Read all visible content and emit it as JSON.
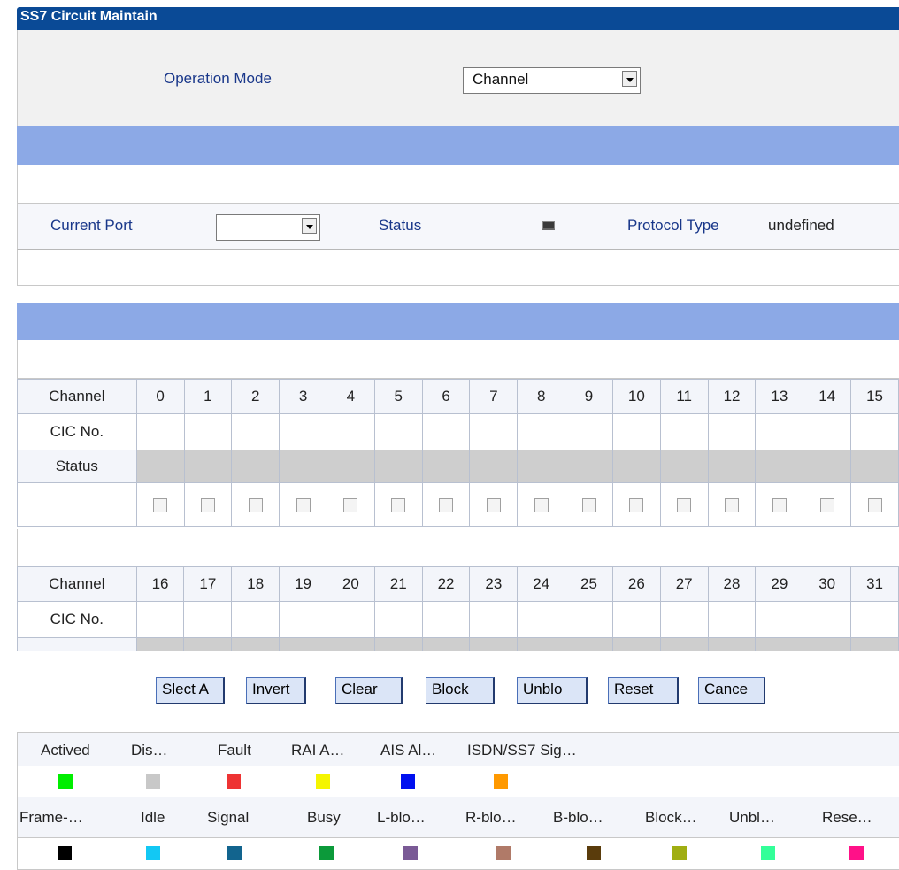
{
  "title": "SS7 Circuit Maintain",
  "operation_mode": {
    "label": "Operation Mode",
    "value": "Channel"
  },
  "port": {
    "label": "Current Port",
    "value": "",
    "status_label": "Status",
    "protocol_label": "Protocol Type",
    "protocol_value": "undefined"
  },
  "table1": {
    "row_labels": [
      "Channel",
      "CIC No.",
      "Status"
    ],
    "channels": [
      "0",
      "1",
      "2",
      "3",
      "4",
      "5",
      "6",
      "7",
      "8",
      "9",
      "10",
      "11",
      "12",
      "13",
      "14",
      "15"
    ]
  },
  "table2": {
    "row_labels": [
      "Channel",
      "CIC No."
    ],
    "channels": [
      "16",
      "17",
      "18",
      "19",
      "20",
      "21",
      "22",
      "23",
      "24",
      "25",
      "26",
      "27",
      "28",
      "29",
      "30",
      "31"
    ]
  },
  "buttons": [
    "Slect A",
    "Invert",
    "Clear",
    "Block",
    "Unblo",
    "Reset",
    "Cance"
  ],
  "legend_row1": [
    {
      "label": "Actived",
      "color": "#00ee00"
    },
    {
      "label": "Dis…",
      "color": "#c8c8c8"
    },
    {
      "label": "Fault",
      "color": "#ee3333"
    },
    {
      "label": "RAI A…",
      "color": "#f5f500"
    },
    {
      "label": "AIS Al…",
      "color": "#0010f0"
    },
    {
      "label": "ISDN/SS7 Sig…",
      "color": "#ff9900"
    }
  ],
  "legend_row2": [
    {
      "label": "Frame-…",
      "color": "#000000"
    },
    {
      "label": "Idle",
      "color": "#12c8f4"
    },
    {
      "label": "Signal",
      "color": "#12648e"
    },
    {
      "label": "Busy",
      "color": "#0c9a3a"
    },
    {
      "label": "L-blo…",
      "color": "#7a5a96"
    },
    {
      "label": "R-blo…",
      "color": "#b07a68"
    },
    {
      "label": "B-blo…",
      "color": "#5a3c0c"
    },
    {
      "label": "Block…",
      "color": "#a0ae12"
    },
    {
      "label": "Unbl…",
      "color": "#33ff99"
    },
    {
      "label": "Rese…",
      "color": "#ff1188"
    }
  ]
}
